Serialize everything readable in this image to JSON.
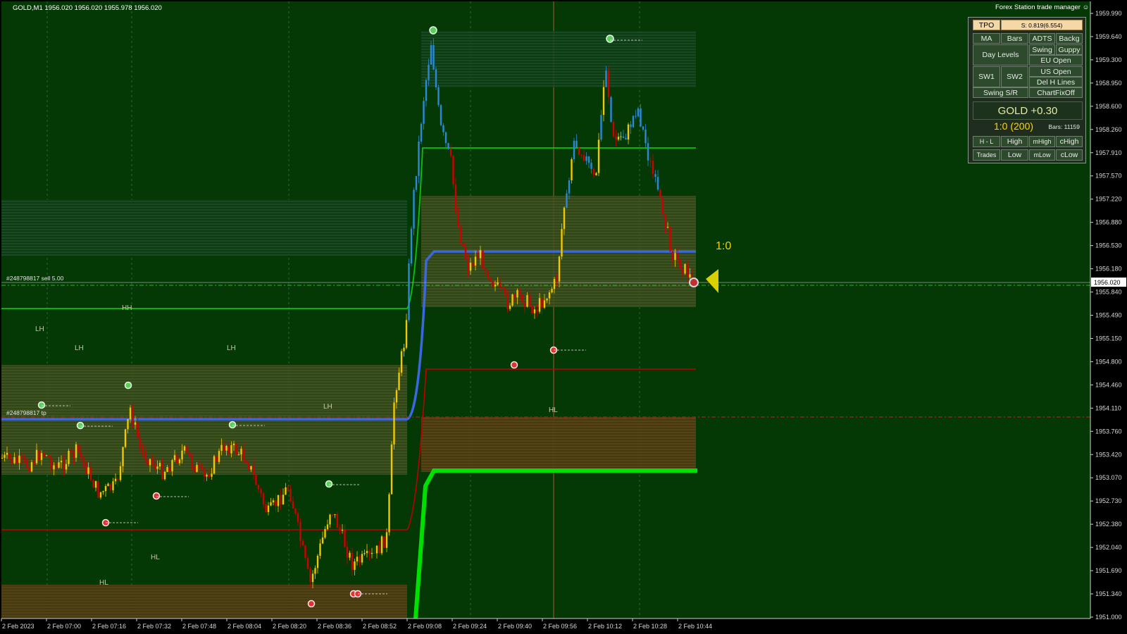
{
  "chart": {
    "symbol_header": "GOLD,M1  1956.020 1956.020 1955.978 1956.020",
    "price_ticks": [
      "1959.990",
      "1959.640",
      "1959.300",
      "1958.950",
      "1958.600",
      "1958.260",
      "1957.910",
      "1957.570",
      "1957.220",
      "1956.880",
      "1956.530",
      "1956.180",
      "1955.840",
      "1955.490",
      "1955.150",
      "1954.800",
      "1954.460",
      "1954.110",
      "1953.760",
      "1953.420",
      "1953.070",
      "1952.730",
      "1952.380",
      "1952.040",
      "1951.690",
      "1951.340",
      "1951.000"
    ],
    "time_ticks": [
      "2 Feb 2023",
      "2 Feb 07:00",
      "2 Feb 07:16",
      "2 Feb 07:32",
      "2 Feb 07:48",
      "2 Feb 08:04",
      "2 Feb 08:20",
      "2 Feb 08:36",
      "2 Feb 08:52",
      "2 Feb 09:08",
      "2 Feb 09:24",
      "2 Feb 09:40",
      "2 Feb 09:56",
      "2 Feb 10:12",
      "2 Feb 10:28",
      "2 Feb 10:44"
    ],
    "current_price_label": "1956.020",
    "order_label_1": "#248798817 sell 5.00",
    "order_label_2": "#248798817 tp",
    "ratio_label": "1:0",
    "swing_labels": [
      "HH",
      "LH",
      "LH",
      "LH",
      "LH",
      "HL",
      "HL",
      "HL"
    ],
    "colors": {
      "background": "#043804",
      "bull_candle": "#f0c800",
      "bear_candle": "#d00000",
      "up_trend_candle": "#2a8ad8",
      "ma_blue": "#3a68e0",
      "ma_green": "#00e000",
      "level_green": "#10c010",
      "level_red": "#c00000"
    }
  },
  "panel": {
    "title": "Forex Station trade manager",
    "tpo": "TPO",
    "spread": "S: 0.819(6.554)",
    "buttons_row1": [
      "MA",
      "Bars",
      "ADTS",
      "Backg"
    ],
    "day_levels": "Day Levels",
    "swing": "Swing",
    "guppy": "Guppy",
    "eu_open": "EU Open",
    "sw1": "SW1",
    "sw2": "SW2",
    "us_open": "US Open",
    "del_h_lines": "Del H Lines",
    "swing_sr": "Swing S/R",
    "chart_fix": "ChartFixOff",
    "gold_status": "GOLD +0.30",
    "ratio": "1:0 (200)",
    "bars": "Bars: 11159",
    "row_hl": [
      "H - L",
      "High",
      "mHigh",
      "cHigh"
    ],
    "row_trades": [
      "Trades",
      "Low",
      "mLow",
      "cLow"
    ]
  }
}
